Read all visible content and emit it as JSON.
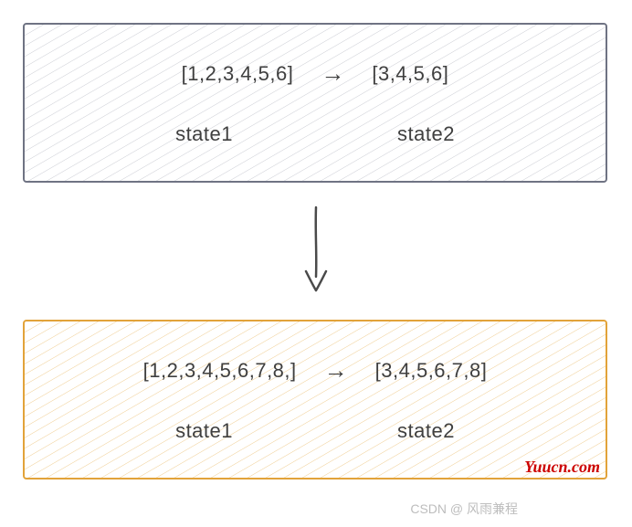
{
  "top_box": {
    "state1_list": "[1,2,3,4,5,6]",
    "state2_list": "[3,4,5,6]",
    "state1_label": "state1",
    "state2_label": "state2",
    "border_color": "#6f7383",
    "hatch_color": "#8b8fa0"
  },
  "bottom_box": {
    "state1_list": "[1,2,3,4,5,6,7,8,]",
    "state2_list": "[3,4,5,6,7,8]",
    "state1_label": "state1",
    "state2_label": "state2",
    "border_color": "#e2a33a",
    "hatch_color": "#e6ae4a"
  },
  "watermarks": {
    "site": "Yuucn.com",
    "csdn": "CSDN @ 风雨兼程"
  },
  "chart_data": {
    "type": "diagram",
    "description": "State transition lists before and after an update",
    "nodes": [
      {
        "id": "top-box",
        "color": "gray",
        "states": [
          {
            "name": "state1",
            "values": [
              1,
              2,
              3,
              4,
              5,
              6
            ]
          },
          {
            "name": "state2",
            "values": [
              3,
              4,
              5,
              6
            ]
          }
        ]
      },
      {
        "id": "bottom-box",
        "color": "orange",
        "states": [
          {
            "name": "state1",
            "values": [
              1,
              2,
              3,
              4,
              5,
              6,
              7,
              8
            ]
          },
          {
            "name": "state2",
            "values": [
              3,
              4,
              5,
              6,
              7,
              8
            ]
          }
        ]
      }
    ],
    "edges": [
      {
        "from": "top-box.state1",
        "to": "top-box.state2",
        "style": "arrow-right"
      },
      {
        "from": "bottom-box.state1",
        "to": "bottom-box.state2",
        "style": "arrow-right"
      },
      {
        "from": "top-box",
        "to": "bottom-box",
        "style": "arrow-down"
      }
    ]
  }
}
